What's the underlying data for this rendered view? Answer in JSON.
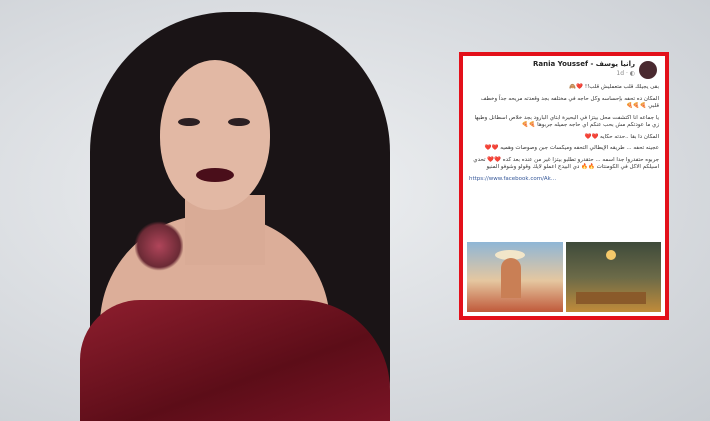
{
  "post": {
    "author": "Rania Youssef - رانيا يوسف",
    "meta": "1d · ◐",
    "paragraphs": [
      "بقى يجيلك قلب متعمليش قلب!! ❤️🙈",
      "المكان ده تحفه بإحساسه وكل حاجه في مختلفه بجد وقعدته مريحه جداً وخطف قلبي 🍕🍕🍕",
      "يا جماعه انا اكتشفت محل بيتزا في البحيرة ابتاي البارود بجد خلاص اسطانل وطبها زي ما عودتكم مش بحب عنكم اي حاجه جميله جربوها 🍕🍕",
      "المكان دا بقا ..حدته حكايه ❤️❤️",
      "عجينه تحفه ... طريقه الإيطالي التحفه وميكسات جبن وصوصات وهميه ❤️❤️",
      "جربوه حتفدروا جدا اسمه ... حتقدرو تطلبو بيتزا غير من عنده بعد كده ❤️❤️ تحدي اسيلكم الاكل في الكومنتات 🔥🔥 دي البيدج اعملو لايك وقولو وشوفو المنيو",
      "https://www.facebook.com/Ak..."
    ]
  }
}
